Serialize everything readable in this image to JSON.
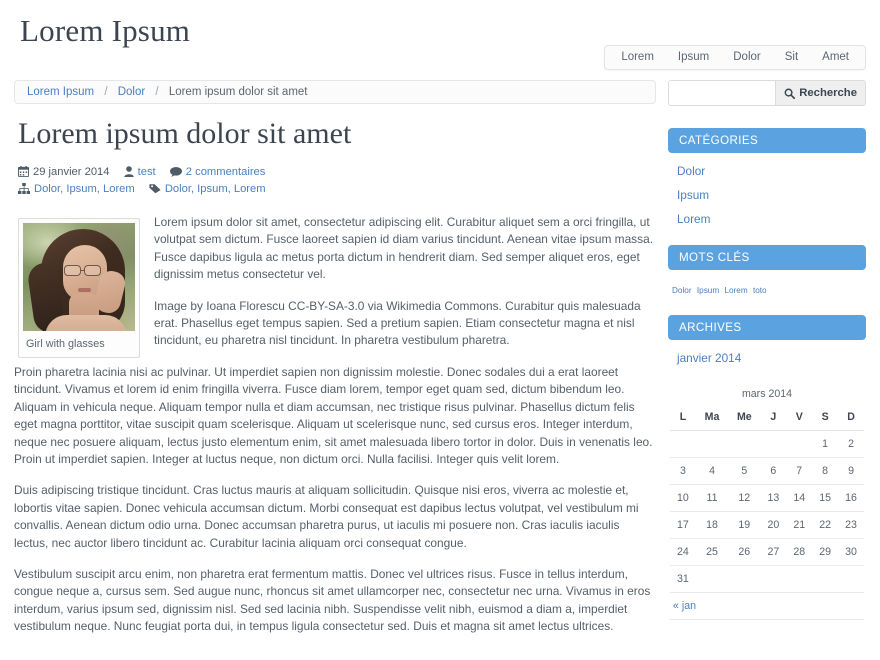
{
  "site": {
    "title": "Lorem Ipsum",
    "nav": [
      {
        "label": "Lorem"
      },
      {
        "label": "Ipsum"
      },
      {
        "label": "Dolor"
      },
      {
        "label": "Sit"
      },
      {
        "label": "Amet"
      }
    ]
  },
  "breadcrumb": {
    "items": [
      {
        "label": "Lorem Ipsum",
        "link": true
      },
      {
        "label": "Dolor",
        "link": true
      },
      {
        "label": "Lorem ipsum dolor sit amet",
        "link": false
      }
    ],
    "separator": "/"
  },
  "article": {
    "title": "Lorem ipsum dolor sit amet",
    "meta": {
      "date": "29 janvier 2014",
      "author": "test",
      "comments": "2 commentaires",
      "categories": "Dolor, Ipsum, Lorem",
      "tags": "Dolor, Ipsum, Lorem",
      "icons": {
        "date": "calendar-icon",
        "author": "user-icon",
        "comments": "comment-icon",
        "categories": "sitemap-icon",
        "tags": "tag-icon"
      }
    },
    "figure": {
      "caption": "Girl with glasses",
      "alt": "Girl with glasses"
    },
    "paragraphs": [
      "Lorem ipsum dolor sit amet, consectetur adipiscing elit. Curabitur aliquet sem a orci fringilla, ut volutpat sem dictum. Fusce laoreet sapien id diam varius tincidunt. Aenean vitae ipsum massa. Fusce dapibus ligula ac metus porta dictum in hendrerit diam. Sed semper aliquet eros, eget dignissim metus consectetur vel.",
      "Image by Ioana Florescu CC-BY-SA-3.0 via Wikimedia Commons. Curabitur quis malesuada erat. Phasellus eget tempus sapien. Sed a pretium sapien. Etiam consectetur magna et nisl tincidunt, eu pharetra nisl tincidunt. In pharetra vestibulum pharetra.",
      "Proin pharetra lacinia nisi ac pulvinar. Ut imperdiet sapien non dignissim molestie. Donec sodales dui a erat laoreet tincidunt. Vivamus et lorem id enim fringilla viverra. Fusce diam lorem, tempor eget quam sed, dictum bibendum leo. Aliquam in vehicula neque. Aliquam tempor nulla et diam accumsan, nec tristique risus pulvinar. Phasellus dictum felis eget magna porttitor, vitae suscipit quam scelerisque. Aliquam ut scelerisque nunc, sed cursus eros. Integer interdum, neque nec posuere aliquam, lectus justo elementum enim, sit amet malesuada libero tortor in dolor. Duis in venenatis leo. Proin ut imperdiet sapien. Integer at luctus neque, non dictum orci. Nulla facilisi. Integer quis velit lorem.",
      "Duis adipiscing tristique tincidunt. Cras luctus mauris at aliquam sollicitudin. Quisque nisi eros, viverra ac molestie et, lobortis vitae sapien. Donec vehicula accumsan dictum. Morbi consequat est dapibus lectus volutpat, vel vestibulum mi convallis. Aenean dictum odio urna. Donec accumsan pharetra purus, ut iaculis mi posuere non. Cras iaculis iaculis lectus, nec auctor libero tincidunt ac. Curabitur lacinia aliquam orci consequat congue.",
      "Vestibulum suscipit arcu enim, non pharetra erat fermentum mattis. Donec vel ultrices risus. Fusce in tellus interdum, congue neque a, cursus sem. Sed augue nunc, rhoncus sit amet ullamcorper nec, consectetur nec urna. Vivamus in eros interdum, varius ipsum sed, dignissim nisl. Sed sed lacinia nibh. Suspendisse velit nibh, euismod a diam a, imperdiet vestibulum neque. Nunc feugiat porta dui, in tempus ligula consectetur sed. Duis et magna sit amet lectus ultrices."
    ]
  },
  "sidebar": {
    "search": {
      "value": "",
      "placeholder": "",
      "button_label": "Recherche",
      "button_icon": "search-icon"
    },
    "widgets": [
      {
        "title": "CATÉGORIES",
        "type": "list",
        "items": [
          {
            "label": "Dolor"
          },
          {
            "label": "Ipsum"
          },
          {
            "label": "Lorem"
          }
        ]
      },
      {
        "title": "MOTS CLÉS",
        "type": "tagcloud",
        "tags": [
          {
            "label": "Dolor"
          },
          {
            "label": "Ipsum"
          },
          {
            "label": "Lorem"
          },
          {
            "label": "toto"
          }
        ]
      },
      {
        "title": "ARCHIVES",
        "type": "list",
        "items": [
          {
            "label": "janvier 2014"
          }
        ]
      }
    ],
    "calendar": {
      "caption": "mars 2014",
      "weekdays": [
        "L",
        "Ma",
        "Me",
        "J",
        "V",
        "S",
        "D"
      ],
      "weeks": [
        [
          "",
          "",
          "",
          "",
          "",
          "1",
          "2"
        ],
        [
          "3",
          "4",
          "5",
          "6",
          "7",
          "8",
          "9"
        ],
        [
          "10",
          "11",
          "12",
          "13",
          "14",
          "15",
          "16"
        ],
        [
          "17",
          "18",
          "19",
          "20",
          "21",
          "22",
          "23"
        ],
        [
          "24",
          "25",
          "26",
          "27",
          "28",
          "29",
          "30"
        ],
        [
          "31",
          "",
          "",
          "",
          "",
          "",
          ""
        ]
      ],
      "prev_label": "« jan",
      "next_label": ""
    }
  },
  "colors": {
    "accent_blue": "#5ba3e0",
    "link_blue": "#4a7fc1",
    "text": "#555f69",
    "heading": "#3c4450"
  }
}
